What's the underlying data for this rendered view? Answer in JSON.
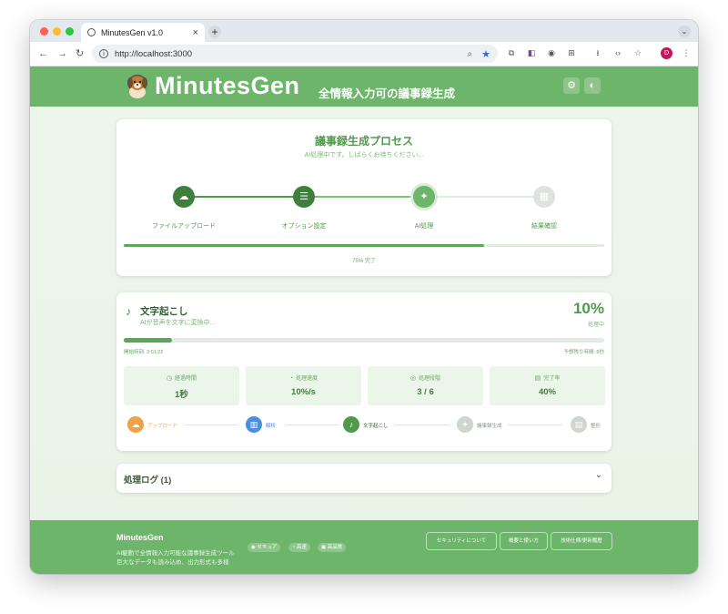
{
  "browser": {
    "tab_title": "MinutesGen v1.0",
    "tab_close": "×",
    "new_tab": "+",
    "tab_menu": "⌄",
    "url": "http://localhost:3000",
    "profile_initial": "D",
    "nav_back": "←",
    "nav_forward": "→",
    "nav_reload": "↻",
    "url_info": "i",
    "url_zoom": "⌕",
    "url_star": "★",
    "ext_1": "⧉",
    "ext_2": "◧",
    "ext_3": "◉",
    "ext_4": "⊞",
    "ext_download": "⭳",
    "ext_code": "‹›",
    "ext_bookmark": "☆",
    "menu": "⋮"
  },
  "header": {
    "brand": "MinutesGen",
    "tagline": "全情報入力可の議事録生成",
    "settings_icon": "⚙",
    "theme_icon": "◐"
  },
  "process": {
    "title": "議事録生成プロセス",
    "subtitle": "AI処理中です。しばらくお待ちください...",
    "steps": [
      {
        "label": "ファイルアップロード",
        "icon": "☁",
        "status": "done"
      },
      {
        "label": "オプション設定",
        "icon": "☰",
        "status": "done"
      },
      {
        "label": "AI処理",
        "icon": "✦",
        "status": "active"
      },
      {
        "label": "結果確認",
        "icon": "▦",
        "status": "pending"
      }
    ],
    "progress": 0.75,
    "progress_label": "75% 完了"
  },
  "transcription": {
    "icon": "♪",
    "title": "文字起こし",
    "subtitle": "AIが音声を文字に変換中...",
    "percent_text": "10%",
    "progress": 0.1,
    "state": "処理中",
    "start_time": "開始時刻: 3:01:22",
    "remaining": "予想残り時間: 8秒",
    "stats": [
      {
        "icon": "◷",
        "label": "経過時間",
        "value": "1秒"
      },
      {
        "icon": "◔",
        "label": "処理速度",
        "value": "10%/s"
      },
      {
        "icon": "◎",
        "label": "処理段階",
        "value": "3 / 6"
      },
      {
        "icon": "▤",
        "label": "完了率",
        "value": "40%"
      }
    ],
    "stages": [
      {
        "label": "アップロード",
        "icon": "☁",
        "color": "#f0a04b"
      },
      {
        "label": "解析",
        "icon": "▥",
        "color": "#4a8fdc"
      },
      {
        "label": "文字起こし",
        "icon": "♪",
        "color": "#4f9a4c"
      },
      {
        "label": "議事録生成",
        "icon": "✦",
        "color": "#cfd6cf"
      },
      {
        "label": "整形",
        "icon": "▤",
        "color": "#cfd6cf"
      }
    ]
  },
  "log": {
    "title": "処理ログ (1)",
    "chevron": "⌄"
  },
  "footer": {
    "title": "MinutesGen",
    "desc_line1": "AI駆動で全情報入力可能な議事録生成ツール",
    "desc_line2": "巨大なデータも読み込め、出力形式も多様",
    "badges": [
      {
        "label": "セキュア",
        "icon": "◉"
      },
      {
        "label": "高速",
        "icon": "◔"
      },
      {
        "label": "高品質",
        "icon": "▣"
      }
    ],
    "buttons": [
      "セキュリティについて",
      "概要と使い方",
      "技術仕様/更新履歴"
    ]
  },
  "colors": {
    "primary": "#6db56a",
    "accent_green": "#4f9a4c",
    "dark_green": "#3f7f3c"
  }
}
